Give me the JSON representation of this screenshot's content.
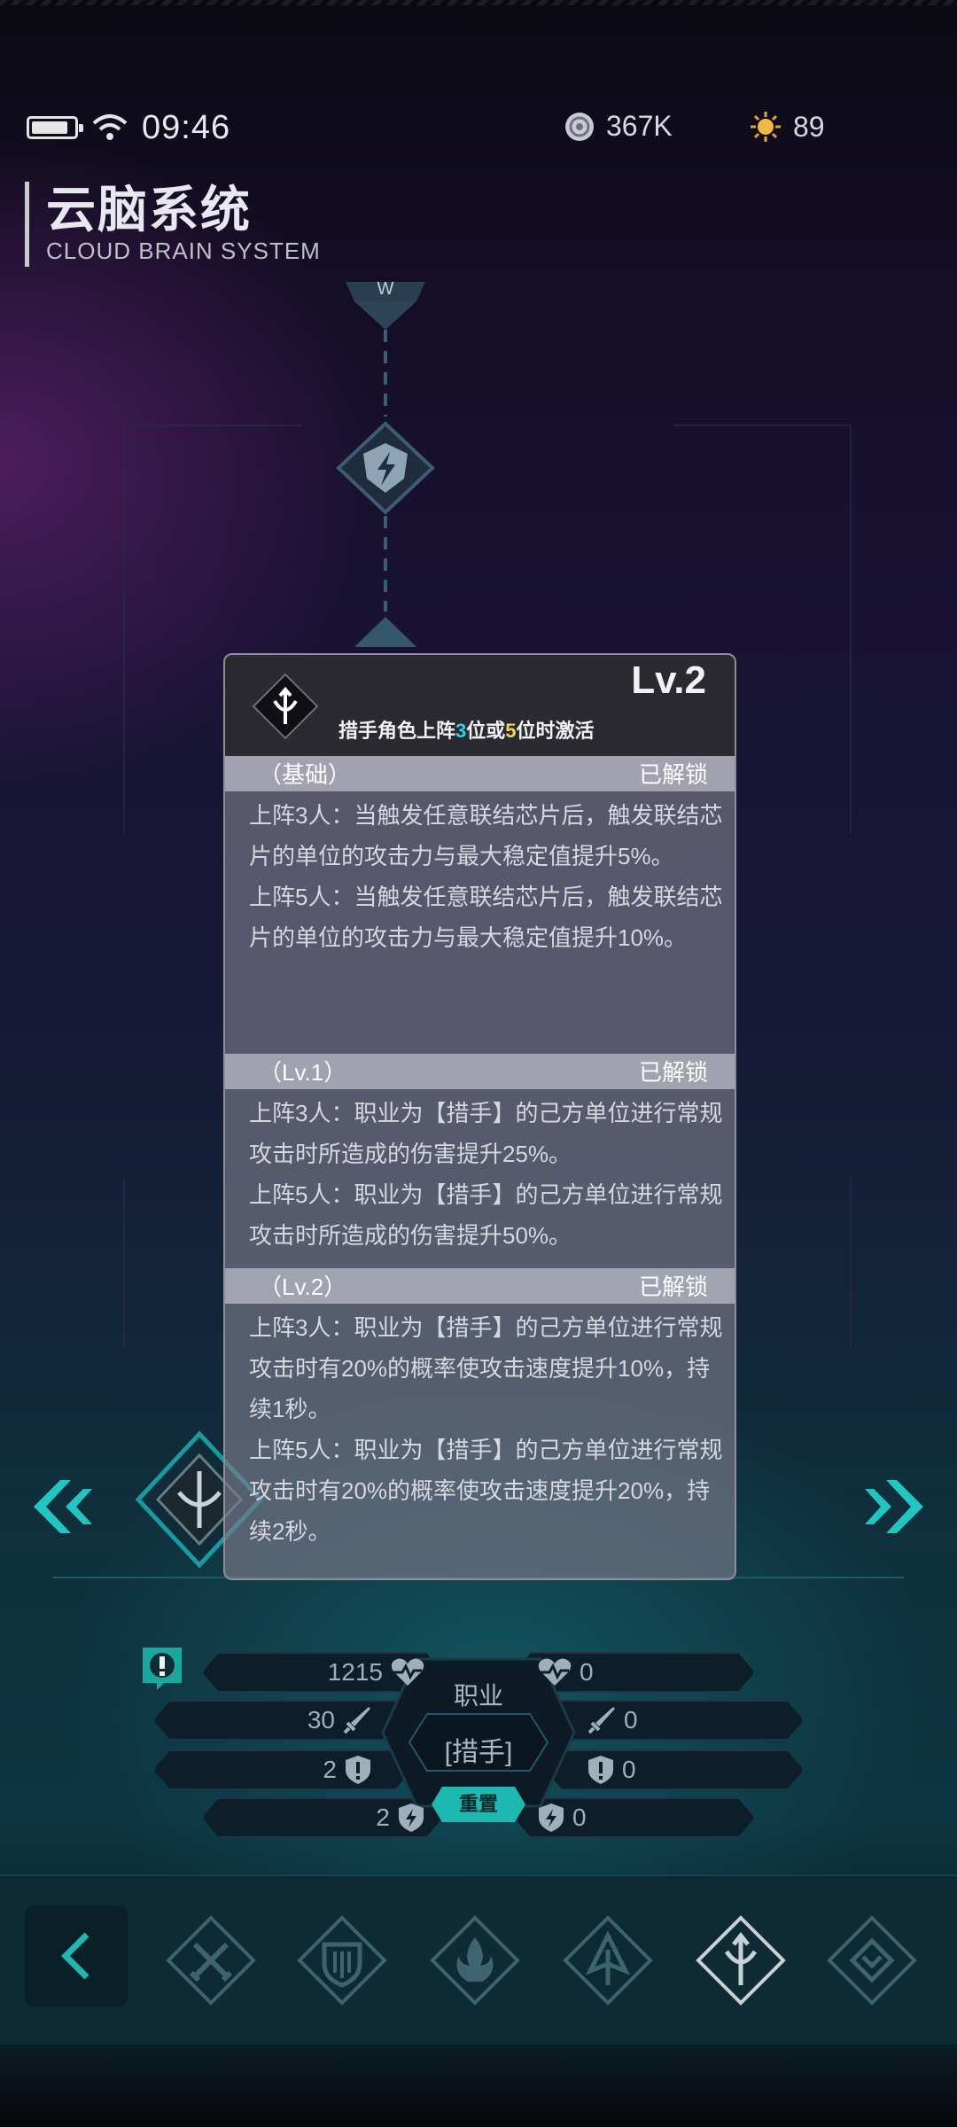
{
  "status_bar": {
    "time": "09:46",
    "battery_level": 0.8
  },
  "resources": [
    {
      "icon": "coin-icon",
      "value": "367K"
    },
    {
      "icon": "sun-energy-icon",
      "value": "89"
    }
  ],
  "title": {
    "cn": "云脑系统",
    "en": "CLOUD BRAIN SYSTEM"
  },
  "popup": {
    "level": "Lv.2",
    "icon": "archer-bow-icon",
    "condition": {
      "pre": "措手角色上阵",
      "n1": "3",
      "mid": "位或",
      "n2": "5",
      "post": "位时激活"
    },
    "sections": [
      {
        "title": "（基础）",
        "status": "已解锁",
        "body": "上阵3人：当触发任意联结芯片后，触发联结芯片的单位的攻击力与最大稳定值提升5%。\n上阵5人：当触发任意联结芯片后，触发联结芯片的单位的攻击力与最大稳定值提升10%。"
      },
      {
        "title": "（Lv.1）",
        "status": "已解锁",
        "body": "上阵3人：职业为【措手】的己方单位进行常规攻击时所造成的伤害提升25%。\n上阵5人：职业为【措手】的己方单位进行常规攻击时所造成的伤害提升50%。"
      },
      {
        "title": "（Lv.2）",
        "status": "已解锁",
        "body": "上阵3人：职业为【措手】的己方单位进行常规攻击时有20%的概率使攻击速度提升10%，持续1秒。\n上阵5人：职业为【措手】的己方单位进行常规攻击时有20%的概率使攻击速度提升20%，持续2秒。"
      }
    ]
  },
  "stats": {
    "left": [
      {
        "value": "1215",
        "icon": "heart-pulse-icon"
      },
      {
        "value": "30",
        "icon": "sword-icon"
      },
      {
        "value": "2",
        "icon": "shield-icon"
      },
      {
        "value": "2",
        "icon": "lightning-icon"
      }
    ],
    "right": [
      {
        "value": "0",
        "icon": "heart-pulse-icon"
      },
      {
        "value": "0",
        "icon": "sword-icon"
      },
      {
        "value": "0",
        "icon": "shield-icon"
      },
      {
        "value": "0",
        "icon": "lightning-icon"
      }
    ],
    "class_label": "职业",
    "class_value": "[措手]",
    "reset_label": "重置"
  },
  "bottom_nav": {
    "items": [
      "twin-swords-icon",
      "shield-crest-icon",
      "flame-icon",
      "arrowhead-icon",
      "archer-bow-icon",
      "wing-crest-icon"
    ],
    "active": 4
  },
  "colors": {
    "accent": "#2fd3e3",
    "highlight": "#f2d64b",
    "teal": "#1fb8b0"
  }
}
